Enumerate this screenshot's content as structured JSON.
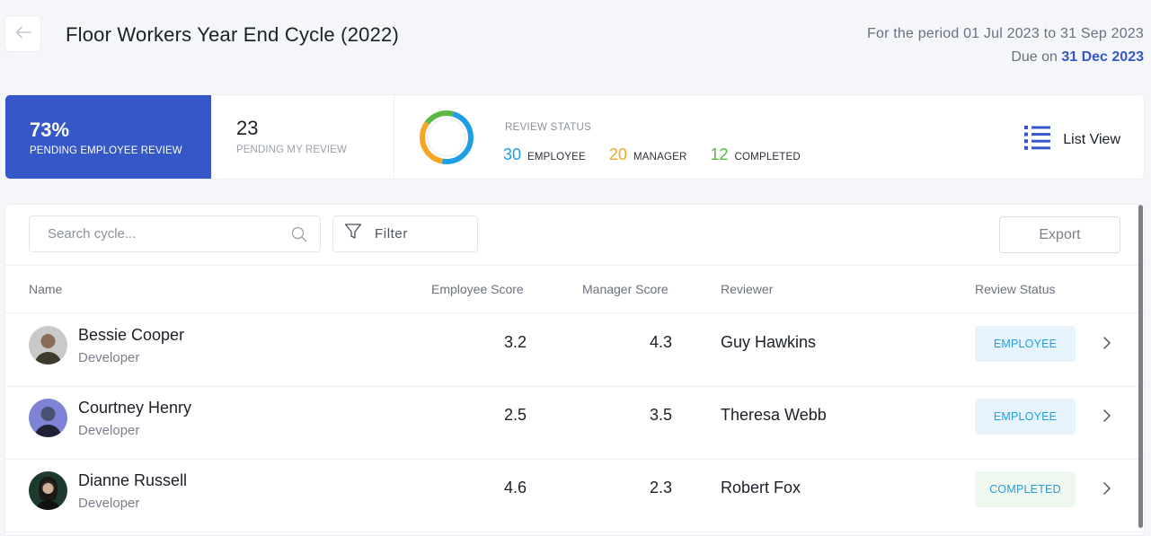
{
  "header": {
    "title": "Floor Workers Year End Cycle (2022)",
    "period": "For the period 01 Jul 2023 to 31 Sep 2023",
    "due_prefix": "Due on",
    "due_date": "31 Dec 2023"
  },
  "stats": {
    "primary": {
      "value": "73%",
      "label": "PENDING EMPLOYEE REVIEW"
    },
    "secondary": {
      "value": "23",
      "label": "PENDING MY REVIEW"
    },
    "review_status": {
      "title": "REVIEW STATUS",
      "items": [
        {
          "count": "30",
          "label": "EMPLOYEE",
          "color": "#1e9fe5"
        },
        {
          "count": "20",
          "label": "MANAGER",
          "color": "#f5a623"
        },
        {
          "count": "12",
          "label": "COMPLETED",
          "color": "#5bb845"
        }
      ]
    },
    "list_view_label": "List View"
  },
  "toolbar": {
    "search_placeholder": "Search cycle...",
    "filter_label": "Filter",
    "export_label": "Export"
  },
  "table": {
    "columns": [
      "Name",
      "Employee Score",
      "Manager Score",
      "Reviewer",
      "Review Status"
    ],
    "rows": [
      {
        "name": "Bessie Cooper",
        "role": "Developer",
        "employee_score": "3.2",
        "manager_score": "4.3",
        "reviewer": "Guy Hawkins",
        "status": "EMPLOYEE"
      },
      {
        "name": "Courtney Henry",
        "role": "Developer",
        "employee_score": "2.5",
        "manager_score": "3.5",
        "reviewer": "Theresa Webb",
        "status": "EMPLOYEE"
      },
      {
        "name": "Dianne Russell",
        "role": "Developer",
        "employee_score": "4.6",
        "manager_score": "2.3",
        "reviewer": "Robert Fox",
        "status": "COMPLETED"
      }
    ]
  },
  "colors": {
    "primary": "#3557c7",
    "employee": "#1e9fe5",
    "manager": "#f5a623",
    "completed": "#5bb845"
  }
}
